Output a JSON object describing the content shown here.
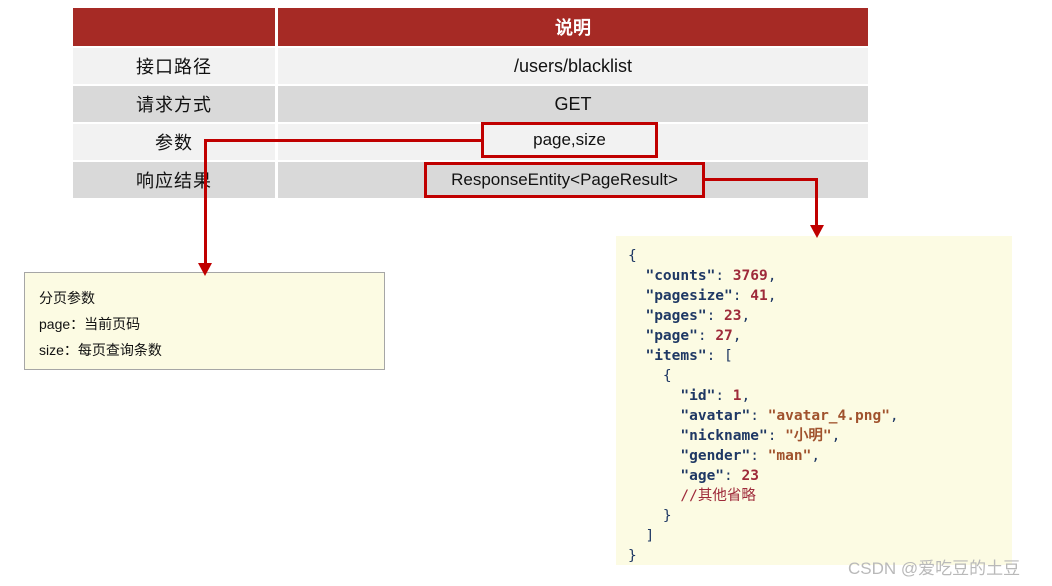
{
  "table": {
    "header": {
      "label_col": "",
      "value_col": "说明"
    },
    "rows": [
      {
        "label": "接口路径",
        "value": "/users/blacklist"
      },
      {
        "label": "请求方式",
        "value": "GET"
      },
      {
        "label": "参数",
        "value": ""
      },
      {
        "label": "响应结果",
        "value": ""
      }
    ]
  },
  "callouts": {
    "params": "page,size",
    "response": "ResponseEntity<PageResult>"
  },
  "note": {
    "title": "分页参数",
    "line1": "page：当前页码",
    "line2": "size：每页查询条数"
  },
  "json_panel": {
    "lines": [
      {
        "indent": 0,
        "parts": [
          {
            "t": "punct",
            "v": "{"
          }
        ]
      },
      {
        "indent": 1,
        "parts": [
          {
            "t": "key",
            "v": "\"counts\""
          },
          {
            "t": "punct",
            "v": ": "
          },
          {
            "t": "num",
            "v": "3769"
          },
          {
            "t": "punct",
            "v": ","
          }
        ]
      },
      {
        "indent": 1,
        "parts": [
          {
            "t": "key",
            "v": "\"pagesize\""
          },
          {
            "t": "punct",
            "v": ": "
          },
          {
            "t": "num",
            "v": "41"
          },
          {
            "t": "punct",
            "v": ","
          }
        ]
      },
      {
        "indent": 1,
        "parts": [
          {
            "t": "key",
            "v": "\"pages\""
          },
          {
            "t": "punct",
            "v": ": "
          },
          {
            "t": "num",
            "v": "23"
          },
          {
            "t": "punct",
            "v": ","
          }
        ]
      },
      {
        "indent": 1,
        "parts": [
          {
            "t": "key",
            "v": "\"page\""
          },
          {
            "t": "punct",
            "v": ": "
          },
          {
            "t": "num",
            "v": "27"
          },
          {
            "t": "punct",
            "v": ","
          }
        ]
      },
      {
        "indent": 1,
        "parts": [
          {
            "t": "key",
            "v": "\"items\""
          },
          {
            "t": "punct",
            "v": ": ["
          }
        ]
      },
      {
        "indent": 2,
        "parts": [
          {
            "t": "punct",
            "v": "{"
          }
        ]
      },
      {
        "indent": 3,
        "parts": [
          {
            "t": "key",
            "v": "\"id\""
          },
          {
            "t": "punct",
            "v": ": "
          },
          {
            "t": "num",
            "v": "1"
          },
          {
            "t": "punct",
            "v": ","
          }
        ]
      },
      {
        "indent": 3,
        "parts": [
          {
            "t": "key",
            "v": "\"avatar\""
          },
          {
            "t": "punct",
            "v": ": "
          },
          {
            "t": "str",
            "v": "\"avatar_4.png\""
          },
          {
            "t": "punct",
            "v": ","
          }
        ]
      },
      {
        "indent": 3,
        "parts": [
          {
            "t": "key",
            "v": "\"nickname\""
          },
          {
            "t": "punct",
            "v": ": "
          },
          {
            "t": "str",
            "v": "\"小明\""
          },
          {
            "t": "punct",
            "v": ","
          }
        ]
      },
      {
        "indent": 3,
        "parts": [
          {
            "t": "key",
            "v": "\"gender\""
          },
          {
            "t": "punct",
            "v": ": "
          },
          {
            "t": "str",
            "v": "\"man\""
          },
          {
            "t": "punct",
            "v": ","
          }
        ]
      },
      {
        "indent": 3,
        "parts": [
          {
            "t": "key",
            "v": "\"age\""
          },
          {
            "t": "punct",
            "v": ": "
          },
          {
            "t": "num",
            "v": "23"
          }
        ]
      },
      {
        "indent": 3,
        "parts": [
          {
            "t": "comment",
            "v": "//其他省略"
          }
        ]
      },
      {
        "indent": 2,
        "parts": [
          {
            "t": "punct",
            "v": "}"
          }
        ]
      },
      {
        "indent": 1,
        "parts": [
          {
            "t": "punct",
            "v": "]"
          }
        ]
      },
      {
        "indent": 0,
        "parts": [
          {
            "t": "punct",
            "v": "}"
          }
        ]
      }
    ]
  },
  "watermark": "CSDN @爱吃豆的土豆",
  "colors": {
    "header_red": "#a62a25",
    "callout_red": "#c00000",
    "row_light": "#f2f2f2",
    "row_dark": "#d9d9d9",
    "note_bg": "#fcfbe3",
    "json_key": "#1f3864",
    "json_number": "#9e2a3a",
    "json_string": "#a0522d"
  }
}
